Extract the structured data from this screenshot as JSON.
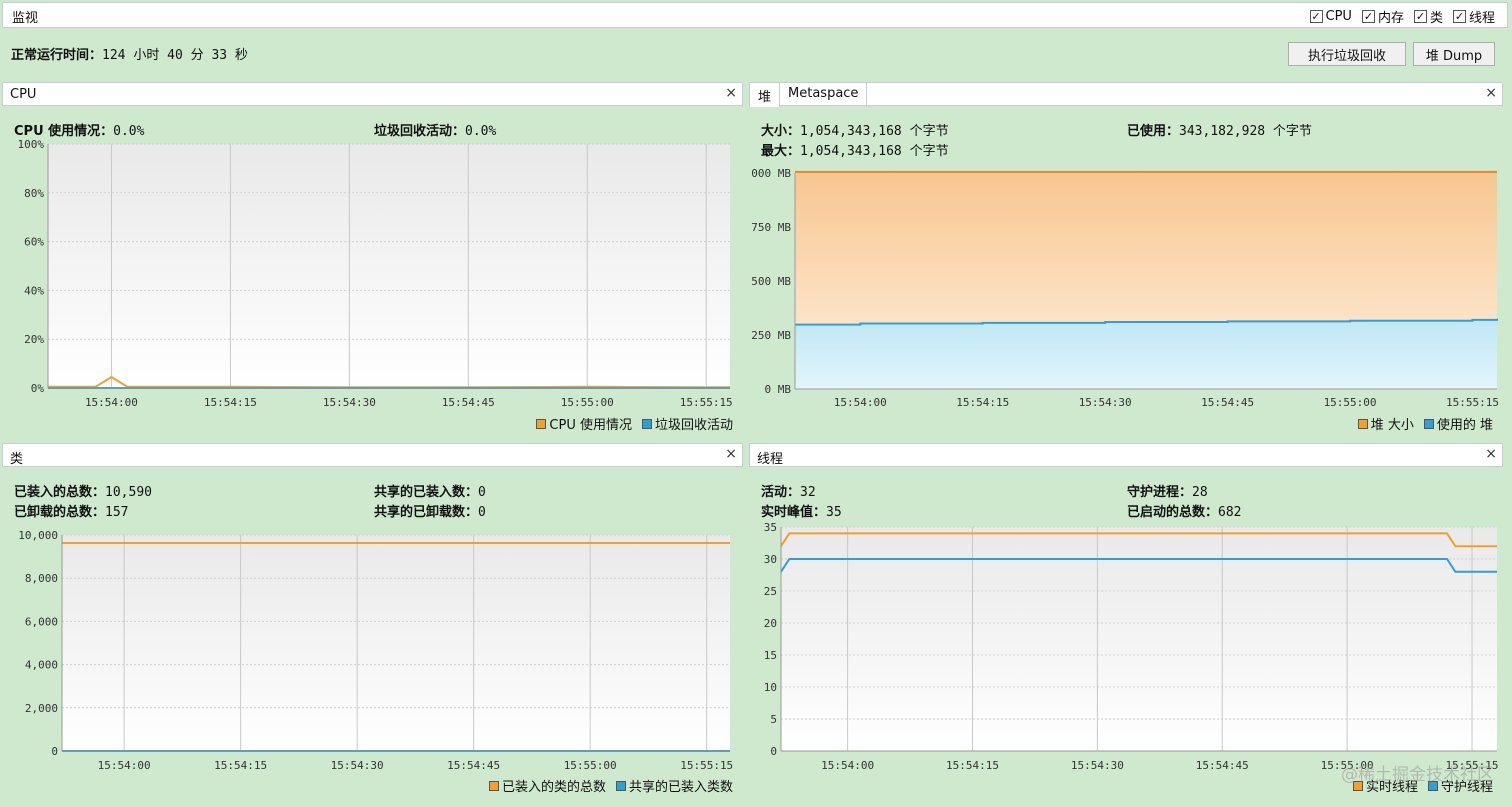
{
  "window": {
    "title": "监视"
  },
  "toggles": [
    {
      "label": "CPU",
      "checked": true
    },
    {
      "label": "内存",
      "checked": true
    },
    {
      "label": "类",
      "checked": true
    },
    {
      "label": "线程",
      "checked": true
    }
  ],
  "uptime": {
    "label": "正常运行时间：",
    "value": "124 小时 40 分 33 秒"
  },
  "buttons": {
    "gc": "执行垃圾回收",
    "dump": "堆 Dump"
  },
  "close_glyph": "×",
  "x_ticks": [
    "15:54:00",
    "15:54:15",
    "15:54:30",
    "15:54:45",
    "15:55:00",
    "15:55:15"
  ],
  "cpu": {
    "title": "CPU",
    "usage_label": "CPU 使用情况：",
    "usage_value": "0.0%",
    "gc_label": "垃圾回收活动：",
    "gc_value": "0.0%",
    "y_ticks": [
      "100%",
      "80%",
      "60%",
      "40%",
      "20%",
      "0%"
    ],
    "legend": [
      "CPU 使用情况",
      "垃圾回收活动"
    ],
    "colors": [
      "#f0a030",
      "#30a0d0"
    ]
  },
  "heap": {
    "tabs": [
      "堆",
      "Metaspace"
    ],
    "size_label": "大小：",
    "size_value": "1,054,343,168 个字节",
    "used_label": "已使用：",
    "used_value": "343,182,928 个字节",
    "max_label": "最大：",
    "max_value": "1,054,343,168 个字节",
    "y_ticks": [
      "1,000 MB",
      "750 MB",
      "500 MB",
      "250 MB",
      "0 MB"
    ],
    "legend": [
      "堆 大小",
      "使用的 堆"
    ],
    "colors": [
      "#f0a030",
      "#30a0d0"
    ]
  },
  "classes": {
    "title": "类",
    "loaded_label": "已装入的总数：",
    "loaded_value": "10,590",
    "unloaded_label": "已卸载的总数：",
    "unloaded_value": "157",
    "shared_loaded_label": "共享的已装入数：",
    "shared_loaded_value": "0",
    "shared_unloaded_label": "共享的已卸载数：",
    "shared_unloaded_value": "0",
    "y_ticks": [
      "10,000",
      "8,000",
      "6,000",
      "4,000",
      "2,000",
      "0"
    ],
    "legend": [
      "已装入的类的总数",
      "共享的已装入类数"
    ],
    "colors": [
      "#f0a030",
      "#30a0d0"
    ]
  },
  "threads": {
    "title": "线程",
    "live_label": "活动：",
    "live_value": "32",
    "daemon_label": "守护进程：",
    "daemon_value": "28",
    "peak_label": "实时峰值：",
    "peak_value": "35",
    "started_label": "已启动的总数：",
    "started_value": "682",
    "y_ticks": [
      "35",
      "30",
      "25",
      "20",
      "15",
      "10",
      "5",
      "0"
    ],
    "legend": [
      "实时线程",
      "守护线程"
    ],
    "colors": [
      "#f0a030",
      "#30a0d0"
    ]
  },
  "watermark": "@稀土掘金技术社区",
  "chart_data": [
    {
      "type": "line",
      "title": "CPU",
      "x": [
        "15:53:52",
        "15:53:58",
        "15:54:00",
        "15:54:02",
        "15:54:15",
        "15:54:30",
        "15:54:45",
        "15:55:00",
        "15:55:15",
        "15:55:18"
      ],
      "ylim": [
        0,
        100
      ],
      "series": [
        {
          "name": "CPU 使用情况",
          "values": [
            0.5,
            0.5,
            4.5,
            0.5,
            0.5,
            0.3,
            0.3,
            0.5,
            0.3,
            0.3
          ]
        },
        {
          "name": "垃圾回收活动",
          "values": [
            0,
            0,
            0,
            0,
            0,
            0,
            0,
            0,
            0,
            0
          ]
        }
      ]
    },
    {
      "type": "area",
      "title": "堆",
      "x": [
        "15:53:52",
        "15:54:00",
        "15:54:15",
        "15:54:30",
        "15:54:45",
        "15:55:00",
        "15:55:15",
        "15:55:18"
      ],
      "ylim": [
        0,
        1000
      ],
      "y_unit": "MB",
      "series": [
        {
          "name": "堆 大小",
          "values": [
            1005,
            1005,
            1005,
            1005,
            1005,
            1005,
            1005,
            1005
          ]
        },
        {
          "name": "使用的 堆",
          "values": [
            298,
            303,
            306,
            310,
            313,
            316,
            320,
            325
          ]
        }
      ]
    },
    {
      "type": "line",
      "title": "类",
      "x": [
        "15:53:52",
        "15:55:18"
      ],
      "ylim": [
        0,
        11000
      ],
      "series": [
        {
          "name": "已装入的类的总数",
          "values": [
            10590,
            10590
          ]
        },
        {
          "name": "共享的已装入类数",
          "values": [
            0,
            0
          ]
        }
      ]
    },
    {
      "type": "line",
      "title": "线程",
      "x": [
        "15:53:52",
        "15:53:53",
        "15:55:12",
        "15:55:13",
        "15:55:18"
      ],
      "ylim": [
        0,
        35
      ],
      "series": [
        {
          "name": "实时线程",
          "values": [
            32,
            34,
            34,
            32,
            32
          ]
        },
        {
          "name": "守护线程",
          "values": [
            28,
            30,
            30,
            28,
            28
          ]
        }
      ]
    }
  ]
}
